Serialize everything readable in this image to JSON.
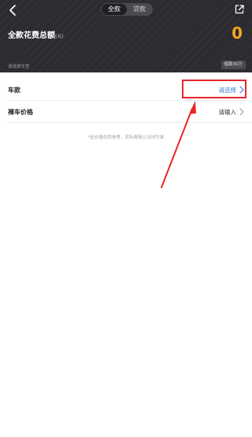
{
  "header": {
    "segments": [
      {
        "label": "全款",
        "active": true
      },
      {
        "label": "贷款",
        "active": false
      }
    ],
    "total_label": "全款花费总额",
    "total_unit": "(元)",
    "total_value": "0",
    "select_hint": "请选择车型",
    "loan_badge": "借款30万"
  },
  "form": {
    "car": {
      "label": "车款",
      "value": "请选择"
    },
    "price": {
      "label": "裸车价格",
      "value": "请输入"
    }
  },
  "disclaimer": "*此价格仅供参考，实际费用以当地为准",
  "colors": {
    "header_bg": "#2b2b30",
    "accent_orange": "#f5a623",
    "link_blue": "#3a7bd5",
    "annotation_red": "#e8262a"
  },
  "icons": {
    "back": "back-arrow-icon",
    "share": "share-icon",
    "chevron": "chevron-right-icon"
  }
}
